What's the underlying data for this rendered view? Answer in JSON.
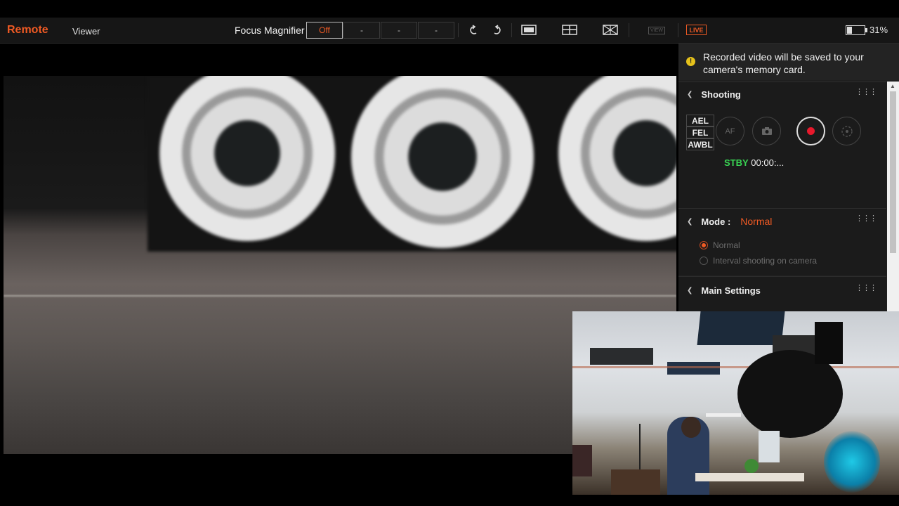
{
  "toolbar": {
    "tab_remote": "Remote",
    "tab_viewer": "Viewer",
    "focus_magnifier_label": "Focus Magnifier",
    "focus_magnifier_options": [
      "Off",
      "-",
      "-",
      "-"
    ],
    "icons": [
      "rotate-left-icon",
      "rotate-right-icon",
      "single-view-icon",
      "split-view-icon",
      "grid-overlay-icon",
      "view-icon"
    ],
    "view_label": "VIEW",
    "live_label": "LIVE",
    "battery_percent": "31%",
    "battery_level": 0.31
  },
  "panel": {
    "notice_text": "Recorded video will be saved to your camera's memory card.",
    "shooting": {
      "title": "Shooting",
      "locks": [
        "AEL",
        "FEL",
        "AWBL"
      ],
      "af_label": "AF",
      "status_code": "STBY",
      "status_time": "00:00:..."
    },
    "mode": {
      "title": "Mode :",
      "value": "Normal",
      "options": [
        "Normal",
        "Interval shooting on camera"
      ],
      "selected": 0
    },
    "main_settings": {
      "title": "Main Settings"
    }
  },
  "colors": {
    "accent": "#ef5a24",
    "record": "#e8192c",
    "status_green": "#39d353",
    "notice_icon": "#e6c21b"
  }
}
